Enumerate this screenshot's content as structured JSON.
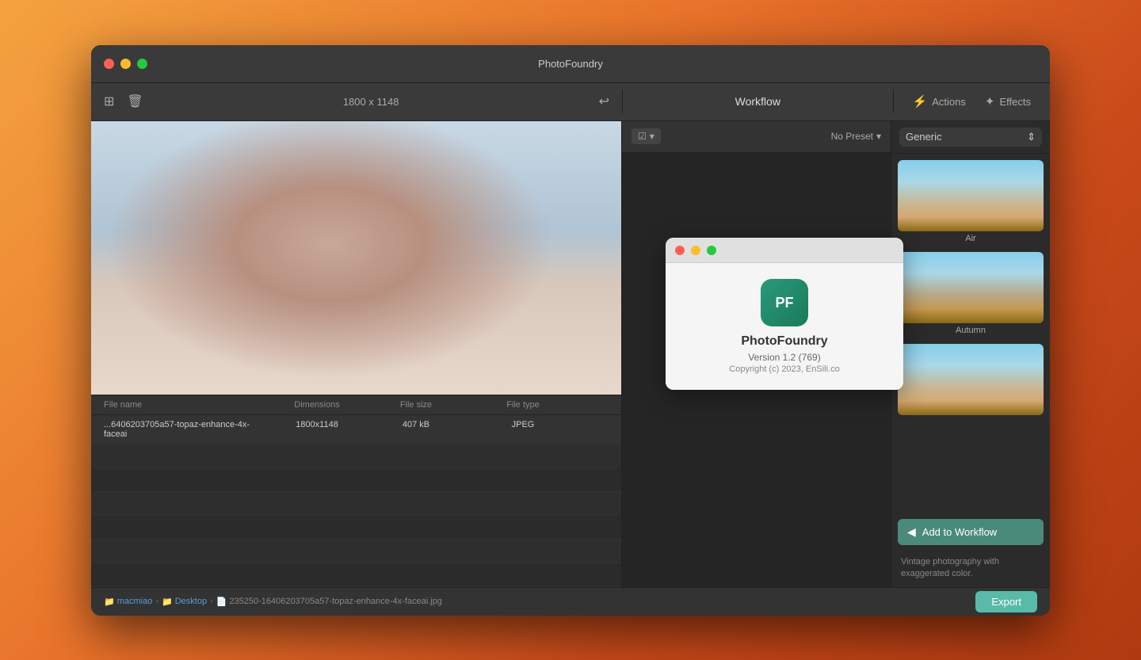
{
  "app": {
    "title": "PhotoFoundry"
  },
  "titlebar": {
    "title": "PhotoFoundry",
    "dimensions": "1800 x 1148"
  },
  "toolbar": {
    "workflow_label": "Workflow",
    "actions_label": "Actions",
    "effects_label": "Effects"
  },
  "file_table": {
    "headers": {
      "name": "File name",
      "dimensions": "Dimensions",
      "size": "File size",
      "type": "File type"
    },
    "rows": [
      {
        "name": "...6406203705a57-topaz-enhance-4x-faceai",
        "dimensions": "1800x1148",
        "size": "407 kB",
        "type": "JPEG"
      }
    ]
  },
  "workflow": {
    "preset_label": "No Preset"
  },
  "effects": {
    "category": "Generic",
    "items": [
      {
        "label": "Air"
      },
      {
        "label": "Autumn"
      },
      {
        "label": ""
      }
    ],
    "add_button": "Add to Workflow",
    "description": "Vintage photography with exaggerated color."
  },
  "about_popup": {
    "app_name": "PhotoFoundry",
    "icon_initials": "PF",
    "version": "Version 1.2 (769)",
    "copyright": "Copyright (c) 2023, EnSili.co"
  },
  "bottom_bar": {
    "breadcrumb": {
      "folder1": "macmiao",
      "folder2": "Desktop",
      "file": "235250-16406203705a57-topaz-enhance-4x-faceai.jpg"
    },
    "export_label": "Export"
  }
}
